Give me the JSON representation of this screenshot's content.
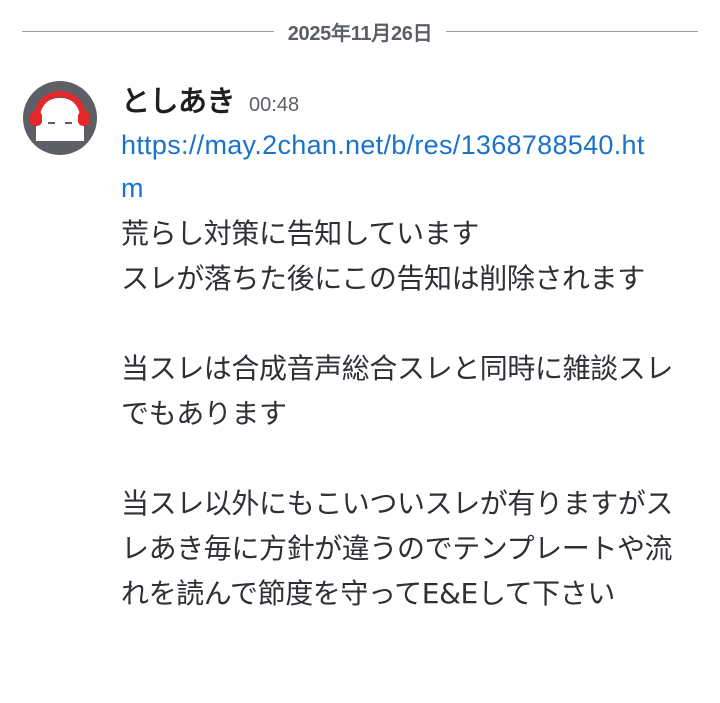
{
  "date_divider": {
    "text": "2025年11月26日"
  },
  "message": {
    "author": "としあき",
    "timestamp": "00:48",
    "avatar_icon": "headphones-ghost-avatar",
    "link": "https://may.2chan.net/b/res/1368788540.htm",
    "text": "荒らし対策に告知しています\nスレが落ちた後にこの告知は削除されます\n\n当スレは合成音声総合スレと同時に雑談スレでもあります\n\n当スレ以外にもこいついスレが有りますがスレあき毎に方針が違うのでテンプレートや流れを読んで節度を守ってE&Eして下さい"
  },
  "colors": {
    "link": "#1a73c9",
    "avatar_bg": "#5d5f64",
    "headphone_red": "#e5262b"
  }
}
